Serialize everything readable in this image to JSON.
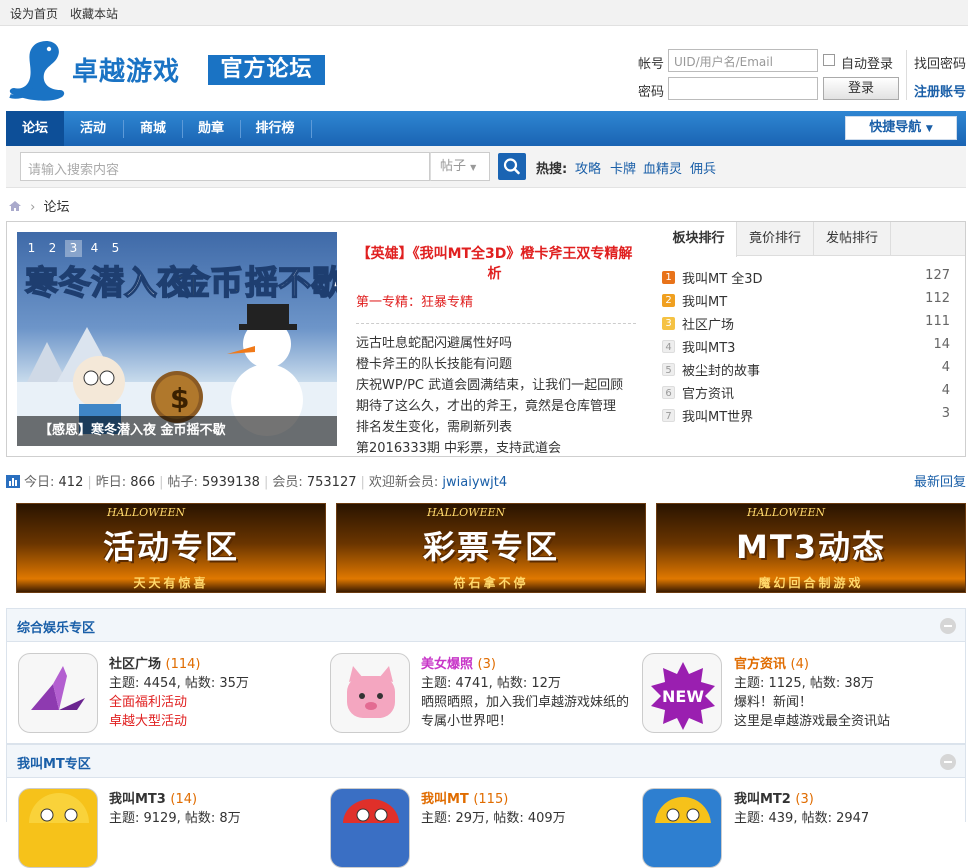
{
  "topbar": {
    "set_home": "设为首页",
    "bookmark": "收藏本站"
  },
  "logo": {
    "title": "卓越游戏",
    "subtitle": "官方论坛"
  },
  "login": {
    "account_label": "帐号",
    "account_placeholder": "UID/用户名/Email",
    "auto_login": "自动登录",
    "find_password": "找回密码",
    "password_label": "密码",
    "login_button": "登录",
    "register": "注册账号"
  },
  "nav": {
    "items": [
      "论坛",
      "活动",
      "商城",
      "勋章",
      "排行榜"
    ],
    "quick_nav": "快捷导航"
  },
  "search": {
    "placeholder": "请输入搜索内容",
    "type": "帖子",
    "hot_label": "热搜:",
    "hot_items": [
      "攻略",
      "卡牌",
      "血精灵",
      "佣兵"
    ]
  },
  "breadcrumb": {
    "current": "论坛"
  },
  "slideshow": {
    "pages": [
      "1",
      "2",
      "3",
      "4",
      "5"
    ],
    "active": 3,
    "art_title_a": "寒冬潜入夜",
    "art_title_b": "金币",
    "art_title_c": "摇不歇",
    "caption": "【感恩】寒冬潜入夜 金币摇不歇"
  },
  "headline": {
    "title": "【英雄】《我叫MT全3D》橙卡斧王双专精解析",
    "sub": "第一专精：狂暴专精",
    "news": [
      "远古吐息蛇配闪避属性好吗",
      "橙卡斧王的队长技能有问题",
      "庆祝WP/PC 武道会圆满结束，让我们一起回顾",
      "期待了这么久，才出的斧王，竟然是仓库管理",
      "排名发生变化，需刷新列表",
      "第2016333期 中彩票，支持武道会"
    ]
  },
  "ranking": {
    "tabs": [
      "板块排行",
      "竟价排行",
      "发帖排行"
    ],
    "rows": [
      {
        "no": "1",
        "name": "我叫MT 全3D",
        "value": "127"
      },
      {
        "no": "2",
        "name": "我叫MT",
        "value": "112"
      },
      {
        "no": "3",
        "name": "社区广场",
        "value": "111"
      },
      {
        "no": "4",
        "name": "我叫MT3",
        "value": "14"
      },
      {
        "no": "5",
        "name": "被尘封的故事",
        "value": "4"
      },
      {
        "no": "6",
        "name": "官方资讯",
        "value": "4"
      },
      {
        "no": "7",
        "name": "我叫MT世界",
        "value": "3"
      }
    ],
    "colors": {
      "first": "#e8731a",
      "second": "#f0a020",
      "third": "#f5c243"
    }
  },
  "stats": {
    "today_label": "今日:",
    "today": "412",
    "yesterday_label": "昨日:",
    "yesterday": "866",
    "posts_label": "帖子:",
    "posts": "5939138",
    "members_label": "会员:",
    "members": "753127",
    "welcome_label": "欢迎新会员:",
    "new_member": "jwiaiywjt4",
    "latest_reply": "最新回复"
  },
  "banners": [
    {
      "title": "活动专区",
      "sub": "天天有惊喜",
      "tag": "HALLOWEEN"
    },
    {
      "title": "彩票专区",
      "sub": "符石拿不停",
      "tag": "HALLOWEEN"
    },
    {
      "title": "MT3动态",
      "sub": "魔幻回合制游戏",
      "tag": "HALLOWEEN"
    }
  ],
  "section1": {
    "title": "综合娱乐专区",
    "forums": [
      {
        "name": "社区广场",
        "count": "(114)",
        "stats": "主题: 4454, 帖数: 35万",
        "line1": "全面福利活动",
        "line2": "卓越大型活动"
      },
      {
        "name": "美女爆照",
        "count": "(3)",
        "stats": "主题: 4741, 帖数: 12万",
        "line1": "晒照晒照，加入我们卓越游戏妹纸的",
        "line2": "专属小世界吧！"
      },
      {
        "name": "官方资讯",
        "count": "(4)",
        "stats": "主题: 1125, 帖数: 38万",
        "line1": "爆料！新闻！",
        "line2": "这里是卓越游戏最全资讯站",
        "badge": "NEW"
      }
    ]
  },
  "section2": {
    "title": "我叫MT专区",
    "forums": [
      {
        "name": "我叫MT3",
        "count": "(14)",
        "stats": "主题: 9129, 帖数: 8万"
      },
      {
        "name": "我叫MT",
        "count": "(115)",
        "stats": "主题: 29万, 帖数: 409万"
      },
      {
        "name": "我叫MT2",
        "count": "(3)",
        "stats": "主题: 439, 帖数: 2947"
      }
    ]
  }
}
